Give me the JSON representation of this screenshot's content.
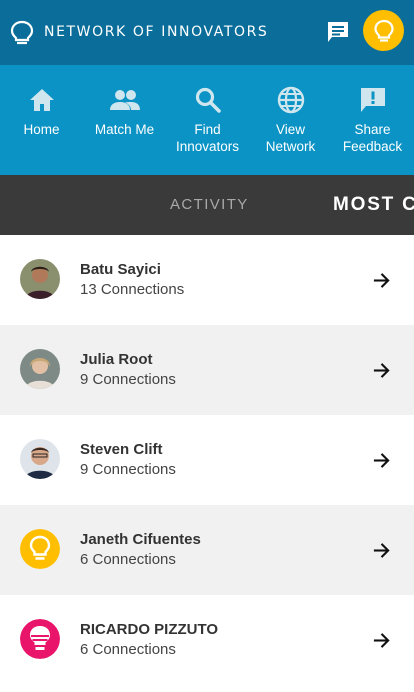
{
  "header": {
    "brand": "NETWORK OF INNOVATORS"
  },
  "nav": [
    {
      "label": "Home",
      "icon": "home-icon"
    },
    {
      "label": "Match Me",
      "icon": "people-icon"
    },
    {
      "label": "Find\nInnovators",
      "icon": "search-icon"
    },
    {
      "label": "View\nNetwork",
      "icon": "globe-icon"
    },
    {
      "label": "Share\nFeedback",
      "icon": "feedback-icon"
    }
  ],
  "tabs": {
    "activity": "ACTIVITY",
    "most_connected": "MOST C"
  },
  "people": [
    {
      "name": "Batu Sayici",
      "connections": "13 Connections"
    },
    {
      "name": "Julia Root",
      "connections": "9 Connections"
    },
    {
      "name": "Steven Clift",
      "connections": "9 Connections"
    },
    {
      "name": "Janeth Cifuentes",
      "connections": "6 Connections"
    },
    {
      "name": "RICARDO PIZZUTO",
      "connections": "6 Connections"
    }
  ],
  "colors": {
    "topbar": "#0b6e9a",
    "navbar": "#0a93c4",
    "tabs_bg": "#3a3a3a",
    "accent_yellow": "#ffbf00",
    "accent_pink": "#e8156b"
  }
}
